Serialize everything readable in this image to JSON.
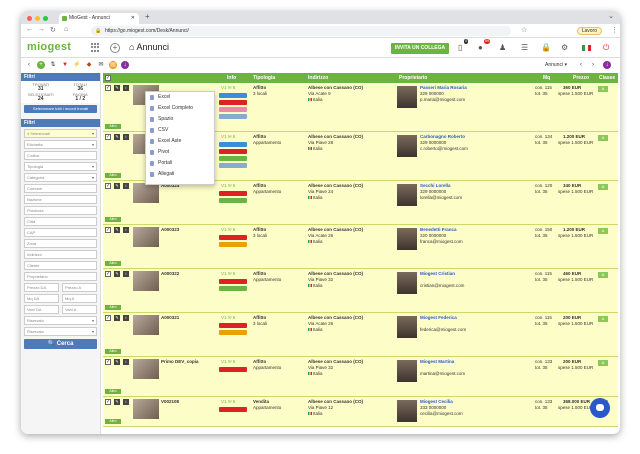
{
  "browser": {
    "tab_title": "MioGest - Annunci",
    "url": "https://go.miogest.com/Desk/Annunci/",
    "profile_label": "Lavoro"
  },
  "app": {
    "logo": "miogest",
    "page_title": "Annunci",
    "invite_button": "INVITA UN COLLEGA",
    "badge_1": "4",
    "badge_2": "99",
    "view_select": "Annunci"
  },
  "sidebar": {
    "filter_panel_title": "Filtri",
    "stats": [
      {
        "label": "TROVATI",
        "value": "31"
      },
      {
        "label": "TOTALI",
        "value": "36"
      },
      {
        "label": "SELEZIONATI",
        "value": "24"
      },
      {
        "label": "PAGINA",
        "value": "1 / 2"
      }
    ],
    "select_all_button": "Selezionare tutti i record trovati",
    "search_panel_title": "Filtri",
    "selected_field": "4 Selezionati",
    "fields": [
      "Etichetta",
      "Codice",
      "Tipologia",
      "Categoria",
      "Comune",
      "Nazione",
      "Provincia",
      "Città",
      "CAP",
      "Zona",
      "Indirizzo",
      "Cliente",
      "Proprietario"
    ],
    "pairs": [
      [
        "Prezzo DA",
        "Prezzo A"
      ],
      [
        "Mq DA",
        "Mq A"
      ],
      [
        "Vani DA",
        "Vani A"
      ]
    ],
    "dropdowns": [
      "Riservato",
      "Riservato"
    ],
    "search_button": "Cerca"
  },
  "table": {
    "headers": [
      "Info",
      "Tipologia",
      "Indirizzo",
      "Proprietario",
      "Mq",
      "Prezzo",
      "Classe"
    ],
    "rows": [
      {
        "code": "",
        "tipo": "Affitto",
        "sub": "3 locali",
        "addr1": "Albese con Cassano (CO)",
        "addr2": "Via Acate 9",
        "country": "Italia",
        "owner": "Passeri Maria Rosaria",
        "phone": "329 000000",
        "email": "p.maria@miogest.com",
        "mq": "con. 115",
        "mq2": "tot. 35",
        "price": "360 EUR",
        "price2": "spese 1.500 EUR",
        "classe": "A"
      },
      {
        "code": "",
        "tipo": "Affitto",
        "sub": "Appartamento",
        "addr1": "Albese con Cassano (CO)",
        "addr2": "Via Piave 28",
        "country": "Italia",
        "owner": "Carbonagno Roberto",
        "phone": "329 0000000",
        "email": "c.roberto@miogest.com",
        "mq": "con. 134",
        "mq2": "tot. 35",
        "price": "1.200 EUR",
        "price2": "spese 1.500 EUR",
        "classe": "A"
      },
      {
        "code": "A000324",
        "tipo": "Affitto",
        "sub": "Appartamento",
        "addr1": "Albese con Cassano (CO)",
        "addr2": "Via Piave 24",
        "country": "Italia",
        "owner": "Secchi Lorella",
        "phone": "329 0000000",
        "email": "lorella@miogest.com",
        "mq": "con. 120",
        "mq2": "tot. 35",
        "price": "340 EUR",
        "price2": "spese 1.500 EUR",
        "classe": "A"
      },
      {
        "code": "A000323",
        "tipo": "Affitto",
        "sub": "3 locali",
        "addr1": "Albese con Cassano (CO)",
        "addr2": "Via Acate 26",
        "country": "Italia",
        "owner": "Benedetti Franca",
        "phone": "320 0000000",
        "email": "franca@miogest.com",
        "mq": "con. 150",
        "mq2": "tot. 35",
        "price": "1.200 EUR",
        "price2": "spese 1.500 EUR",
        "classe": "A"
      },
      {
        "code": "A000322",
        "tipo": "Affitto",
        "sub": "Appartamento",
        "addr1": "Albese con Cassano (CO)",
        "addr2": "Via Piave 32",
        "country": "Italia",
        "owner": "Miogest Cristian",
        "phone": "",
        "email": "cristian@miogest.com",
        "mq": "con. 115",
        "mq2": "tot. 35",
        "price": "460 EUR",
        "price2": "spese 1.500 EUR",
        "classe": "A"
      },
      {
        "code": "A000321",
        "tipo": "Affitto",
        "sub": "3 locali",
        "addr1": "Albese con Cassano (CO)",
        "addr2": "Via Acate 26",
        "country": "Italia",
        "owner": "Miogest Federica",
        "phone": "",
        "email": "federica@miogest.com",
        "mq": "con. 115",
        "mq2": "tot. 35",
        "price": "200 EUR",
        "price2": "spese 1.500 EUR",
        "classe": "A"
      },
      {
        "code": "Primo DEV_copia",
        "tipo": "Affitto",
        "sub": "Appartamento",
        "addr1": "Albese con Cassano (CO)",
        "addr2": "Via Piave 32",
        "country": "Italia",
        "owner": "Miogest Martina",
        "phone": "",
        "email": "martina@miogest.com",
        "mq": "con. 133",
        "mq2": "tot. 35",
        "price": "200 EUR",
        "price2": "spese 1.500 EUR",
        "classe": "A"
      },
      {
        "code": "V002108",
        "tipo": "Vendita",
        "sub": "Appartamento",
        "addr1": "Albese con Cassano (CO)",
        "addr2": "Via Piave 12",
        "country": "Italia",
        "owner": "Miogest Cecilia",
        "phone": "333 0000000",
        "email": "cecilia@miogest.com",
        "mq": "con. 133",
        "mq2": "tot. 35",
        "price": "368.000 EUR",
        "price2": "spese 1.500 EUR",
        "classe": "A"
      }
    ],
    "altro": "Altro"
  },
  "export_menu": [
    "Excel",
    "Excel Completo",
    "Spazio",
    "CSV",
    "Excel Aste",
    "Pivot",
    "Portali",
    "Allegati"
  ],
  "colors": {
    "brand": "#6cb33f",
    "panel": "#4e7bb8",
    "row": "#fdfdc8"
  }
}
